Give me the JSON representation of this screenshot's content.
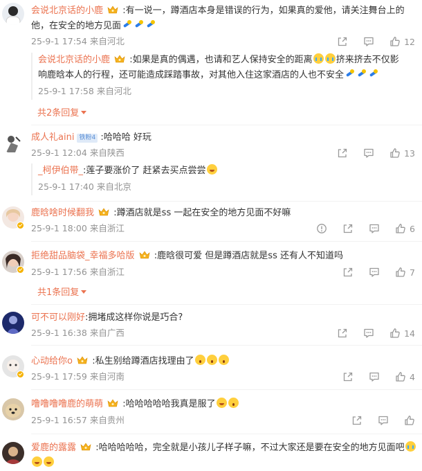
{
  "comments": [
    {
      "user": "会说北京话的小鹿",
      "text": ":有一说一，蹲酒店本身是错误的行为，如果真的爱他，请关注舞台上的",
      "text2": "他，在安全的地方见面",
      "time": "25-9-1 17:54",
      "loc": "来自河北",
      "likes": "12",
      "reply": {
        "user": "会说北京话的小鹿",
        "text": ":如果是真的偶遇，也请和艺人保持安全的距离",
        "text_b": "挤来挤去不仅影",
        "text2": "响鹿晗本人的行程，还可能造成踩踏事故，对其他入住这家酒店的人也不安全",
        "time": "25-9-1 17:58",
        "loc": "来自河北"
      },
      "more": "共2条回复"
    },
    {
      "user": "成人礼aini",
      "badge": "铁粉4",
      "text": ":哈哈哈 好玩",
      "time": "25-9-1 12:04",
      "loc": "来自陕西",
      "likes": "13",
      "reply": {
        "user": "_柯伊伯带_",
        "text": ":莲子要涨价了 赶紧去买点尝尝",
        "time": "25-9-1 17:40",
        "loc": "来自北京"
      }
    },
    {
      "user": "鹿晗啥时候翻我",
      "text": ":蹲酒店就是ss  一起在安全的地方见面不好嘛",
      "time": "25-9-1 18:00",
      "loc": "来自浙江",
      "likes": "6"
    },
    {
      "user": "拒绝甜品脑袋_幸福多哈版",
      "text": ":鹿晗很可爱 但是蹲酒店就是ss 还有人不知道吗",
      "time": "25-9-1 17:56",
      "loc": "来自浙江",
      "likes": "7",
      "more": "共1条回复"
    },
    {
      "user": "可不可以刚好",
      "text": ":拥堵成这样你说是巧合?",
      "time": "25-9-1 16:38",
      "loc": "来自广西",
      "likes": "14"
    },
    {
      "user": "心动给你o",
      "text": ":私生别给蹲酒店找理由了",
      "time": "25-9-1 17:59",
      "loc": "来自河南",
      "likes": "4"
    },
    {
      "user": "噜噜噜噜鹿的萌萌",
      "text": ":哈哈哈哈哈我真是服了",
      "time": "25-9-1 16:57",
      "loc": "来自贵州"
    },
    {
      "user": "爱鹿的露露",
      "text": ":哈哈哈哈哈，完全就是小孩儿子样子嘛，不过大家还是要在安全的地方见面吧"
    }
  ],
  "icons": {
    "share": "share-icon",
    "comment": "comment-icon",
    "like": "thumbs-up-icon",
    "report": "report-icon",
    "crown": "crown-badge-icon",
    "verified": "verified-badge-icon"
  },
  "colors": {
    "username": "#eb7350",
    "meta": "#939393",
    "text": "#333333"
  }
}
